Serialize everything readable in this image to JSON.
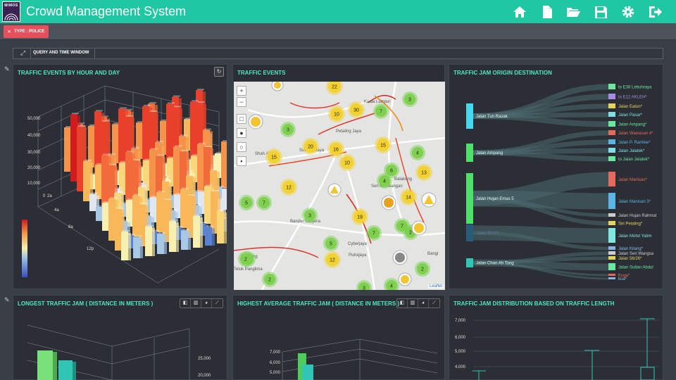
{
  "header": {
    "logo_text": "MIMOS",
    "title": "Crowd Management System",
    "icons": [
      "home-icon",
      "file-icon",
      "folder-open-icon",
      "save-icon",
      "gear-icon",
      "logout-icon"
    ],
    "accent_color": "#1fc7a3"
  },
  "filter": {
    "remove": "×",
    "chip_label": "TYPE : POLICE",
    "chip_color": "#e6505c"
  },
  "query_bar": {
    "title": "QUERY AND TIME WINDOW"
  },
  "panels": {
    "hourly": {
      "title": "TRAFFIC EVENTS BY HOUR AND DAY",
      "y_ticks": [
        "50,000",
        "40,000",
        "30,000",
        "20,000",
        "10,000",
        "0"
      ],
      "x_ticks": [
        "2a",
        "4a",
        "8a",
        "12p"
      ]
    },
    "events": {
      "title": "TRAFFIC EVENTS",
      "places": [
        "Kuala Lumpur",
        "Petaling Jaya",
        "Subang Jaya",
        "Shah Alam",
        "Bandar Saujana",
        "Puchong",
        "Seri Kembangan",
        "Balakong",
        "Cyberjaya",
        "Putrajaya",
        "Bangi",
        "Teluk Panglima"
      ],
      "clusters": [
        "22",
        "10",
        "30",
        "7",
        "3",
        "3",
        "20",
        "16",
        "15",
        "15",
        "4",
        "10",
        "6",
        "13",
        "4",
        "12",
        "5",
        "7",
        "14",
        "3",
        "19",
        "7",
        "7",
        "2",
        "5",
        "3",
        "2",
        "12",
        "3",
        "2",
        "3",
        "4",
        "2"
      ],
      "leaflet": "Leaflet"
    },
    "od": {
      "title": "TRAFFIC JAM ORIGIN DESTINATION",
      "sources": [
        "Jalan Tun Razak",
        "Jalan Ampang",
        "Jalan Hujan Emas 5",
        "Jalan SM3X",
        "Jalan Chan Ah Tong"
      ],
      "targets": [
        {
          "label": "to E38 Lebuhraya",
          "color": "#6ae8a0"
        },
        {
          "label": "to E12 AKLEH*",
          "color": "#a48be6"
        },
        {
          "label": "Jalan Eaton*",
          "color": "#e6d35a"
        },
        {
          "label": "Jalan Pasar*",
          "color": "#7fe0e8"
        },
        {
          "label": "Jalan Ampang*",
          "color": "#6ae8a0"
        },
        {
          "label": "Jalan Wawasan 4*",
          "color": "#e66a5a"
        },
        {
          "label": "Jalan P. Ramlee*",
          "color": "#5ab4e6"
        },
        {
          "label": "Jalan Jalatek*",
          "color": "#7fe0e8"
        },
        {
          "label": "to Jalan Jelatek*",
          "color": "#6ae8a0"
        },
        {
          "label": "Jalan Manisan*",
          "color": "#e66a5a"
        },
        {
          "label": "Jalan Manisan 3*",
          "color": "#5ab4e6"
        },
        {
          "label": "Jalan Hujan Rahmat",
          "color": "#cccccc"
        },
        {
          "label": "Siri Petaling*",
          "color": "#e6d35a"
        },
        {
          "label": "Jalan Mohd Yatim",
          "color": "#7fe8e0"
        },
        {
          "label": "Jalan Kilang*",
          "color": "#8ab4e6"
        },
        {
          "label": "Jalan Seri Wangsa",
          "color": "#cccccc"
        },
        {
          "label": "Jalan 56/26*",
          "color": "#e6d35a"
        },
        {
          "label": "Jalan Sultan Abdul",
          "color": "#6ae8a0"
        },
        {
          "label": "Kuga*",
          "color": "#e66a5a"
        },
        {
          "label": "kua*",
          "color": "#8ab4e6"
        }
      ]
    },
    "longest": {
      "title": "LONGEST TRAFFIC JAM ( DISTANCE IN METERS )",
      "y_ticks": [
        "25,000",
        "20,000"
      ]
    },
    "highest": {
      "title": "HIGHEST AVERAGE TRAFFIC JAM ( DISTANCE IN METERS )",
      "y_ticks": [
        "7,000",
        "6,000",
        "5,000"
      ]
    },
    "distribution": {
      "title": "TRAFFIC JAM DISTRIBUTION BASED ON TRAFFIC LENGTH",
      "y_ticks": [
        "7,000",
        "6,000",
        "5,000",
        "4,000"
      ]
    }
  }
}
